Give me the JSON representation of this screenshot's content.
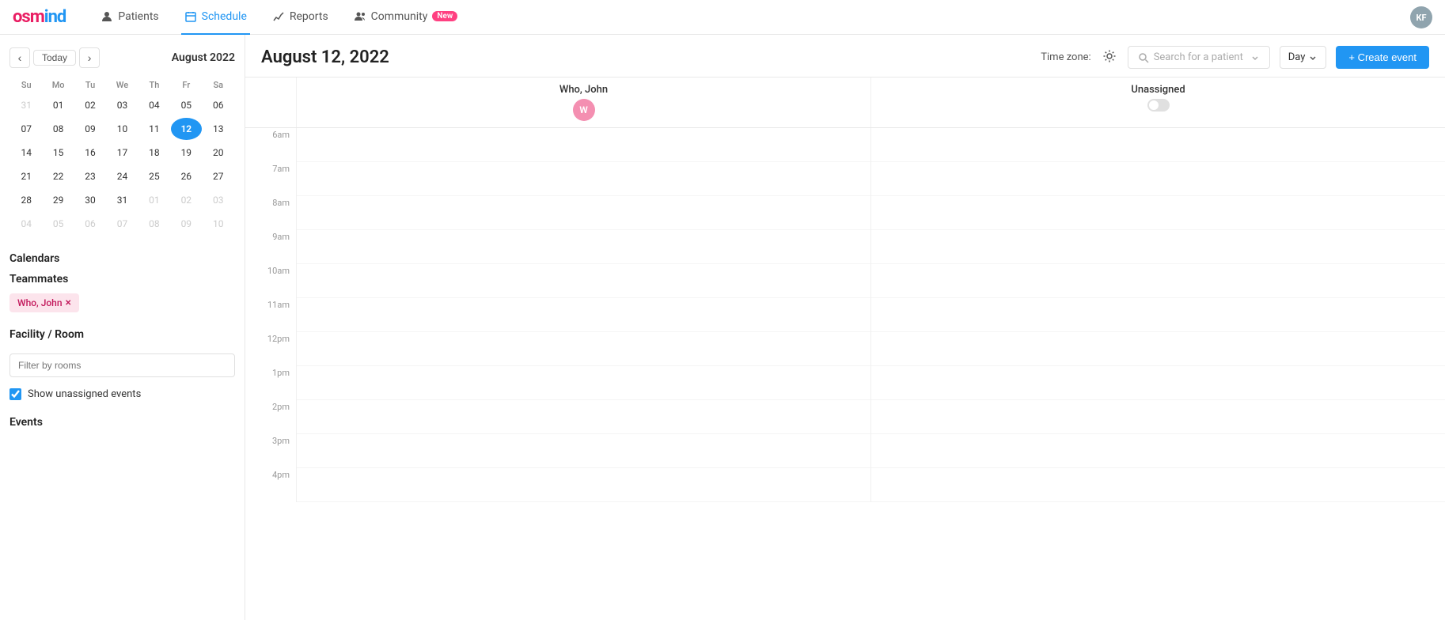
{
  "app": {
    "logo": "osmind",
    "user_initials": "KF"
  },
  "nav": {
    "items": [
      {
        "id": "patients",
        "label": "Patients",
        "icon": "person-icon",
        "active": false
      },
      {
        "id": "schedule",
        "label": "Schedule",
        "icon": "calendar-icon",
        "active": true
      },
      {
        "id": "reports",
        "label": "Reports",
        "icon": "chart-icon",
        "active": false
      },
      {
        "id": "community",
        "label": "Community",
        "icon": "people-icon",
        "active": false,
        "badge": "New"
      }
    ]
  },
  "sidebar": {
    "mini_calendar": {
      "month_year": "August 2022",
      "days_of_week": [
        "Su",
        "Mo",
        "Tu",
        "We",
        "Th",
        "Fr",
        "Sa"
      ],
      "weeks": [
        [
          "31",
          "01",
          "02",
          "03",
          "04",
          "05",
          "06"
        ],
        [
          "07",
          "08",
          "09",
          "10",
          "11",
          "12",
          "13"
        ],
        [
          "14",
          "15",
          "16",
          "17",
          "18",
          "19",
          "20"
        ],
        [
          "21",
          "22",
          "23",
          "24",
          "25",
          "26",
          "27"
        ],
        [
          "28",
          "29",
          "30",
          "31",
          "01",
          "02",
          "03"
        ],
        [
          "04",
          "05",
          "06",
          "07",
          "08",
          "09",
          "10"
        ]
      ],
      "other_month_start_week1": 1,
      "other_month_end_week5": 4,
      "other_month_week6_all": true,
      "selected_day": "12",
      "selected_week": 1,
      "selected_col": 5
    },
    "calendars_label": "Calendars",
    "teammates_label": "Teammates",
    "teammate_tag": "Who, John",
    "facility_room_label": "Facility / Room",
    "room_filter_placeholder": "Filter by rooms",
    "show_unassigned_label": "Show unassigned events",
    "show_unassigned_checked": true,
    "events_label": "Events"
  },
  "content": {
    "date": "August 12, 2022",
    "timezone_label": "Time zone:",
    "patient_search_placeholder": "Search for a patient",
    "view_selector": "Day",
    "create_event_label": "+ Create event",
    "columns": [
      {
        "name": "Who, John",
        "avatar_initial": "W",
        "avatar_color": "#f48fb1"
      },
      {
        "name": "Unassigned",
        "avatar_initial": null,
        "avatar_color": "#e0e0e0"
      }
    ],
    "time_slots": [
      "6am",
      "7am",
      "8am",
      "9am",
      "10am",
      "11am",
      "12pm",
      "1pm",
      "2pm",
      "3pm",
      "4pm"
    ]
  }
}
